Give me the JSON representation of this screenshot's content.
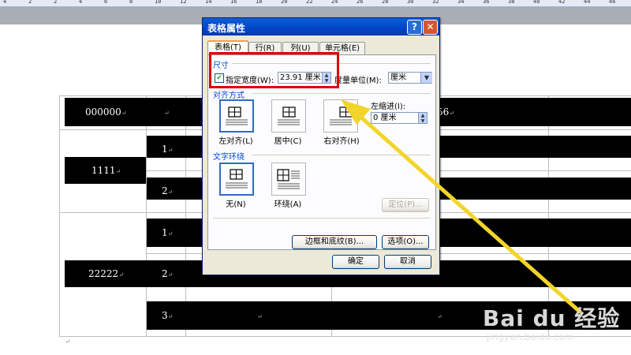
{
  "ruler": {
    "ticks": [
      "4",
      "2",
      "2",
      "4",
      "6",
      "8",
      "10",
      "12",
      "14",
      "16",
      "18",
      "20",
      "22",
      "24",
      "26",
      "28",
      "30",
      "32",
      "34",
      "36",
      "38",
      "40",
      "42",
      "44",
      "46"
    ]
  },
  "table": {
    "cells": {
      "r1_col1": "000000",
      "r1_col2": "",
      "r1_right": "56",
      "r2_col1": "1111",
      "r2_sub1": "1",
      "r2_sub2": "2",
      "r3_col1": "22222",
      "r3_sub1": "1",
      "r3_sub2": "2",
      "r3_sub3": "3"
    },
    "paragraph_mark": "↵"
  },
  "dialog": {
    "title": "表格属性",
    "help_button": "?",
    "close_button": "✕",
    "tabs": [
      {
        "label": "表格(T)",
        "active": true
      },
      {
        "label": "行(R)",
        "active": false
      },
      {
        "label": "列(U)",
        "active": false
      },
      {
        "label": "单元格(E)",
        "active": false
      }
    ],
    "size": {
      "section_label": "尺寸",
      "checkbox_checked": true,
      "width_label": "指定宽度(W):",
      "width_value": "23.91 厘米",
      "unit_label": "度量单位(M):",
      "unit_value": "厘米"
    },
    "alignment": {
      "section_label": "对齐方式",
      "left_label": "左对齐(L)",
      "center_label": "居中(C)",
      "right_label": "右对齐(H)",
      "indent_label": "左缩进(I):",
      "indent_value": "0 厘米",
      "selected": "left"
    },
    "wrapping": {
      "section_label": "文字环绕",
      "none_label": "无(N)",
      "around_label": "环绕(A)",
      "selected": "none"
    },
    "buttons": {
      "position": "定位(P)...",
      "borders": "边框和底纹(B)...",
      "options": "选项(O)...",
      "ok": "确定",
      "cancel": "取消"
    }
  },
  "watermark": {
    "text": "Bai du 经验",
    "url": "jingyan.baidu.com"
  },
  "colors": {
    "highlight_box": "#e00000",
    "arrow": "#f2d52a",
    "title_bar": "#0343c5"
  }
}
